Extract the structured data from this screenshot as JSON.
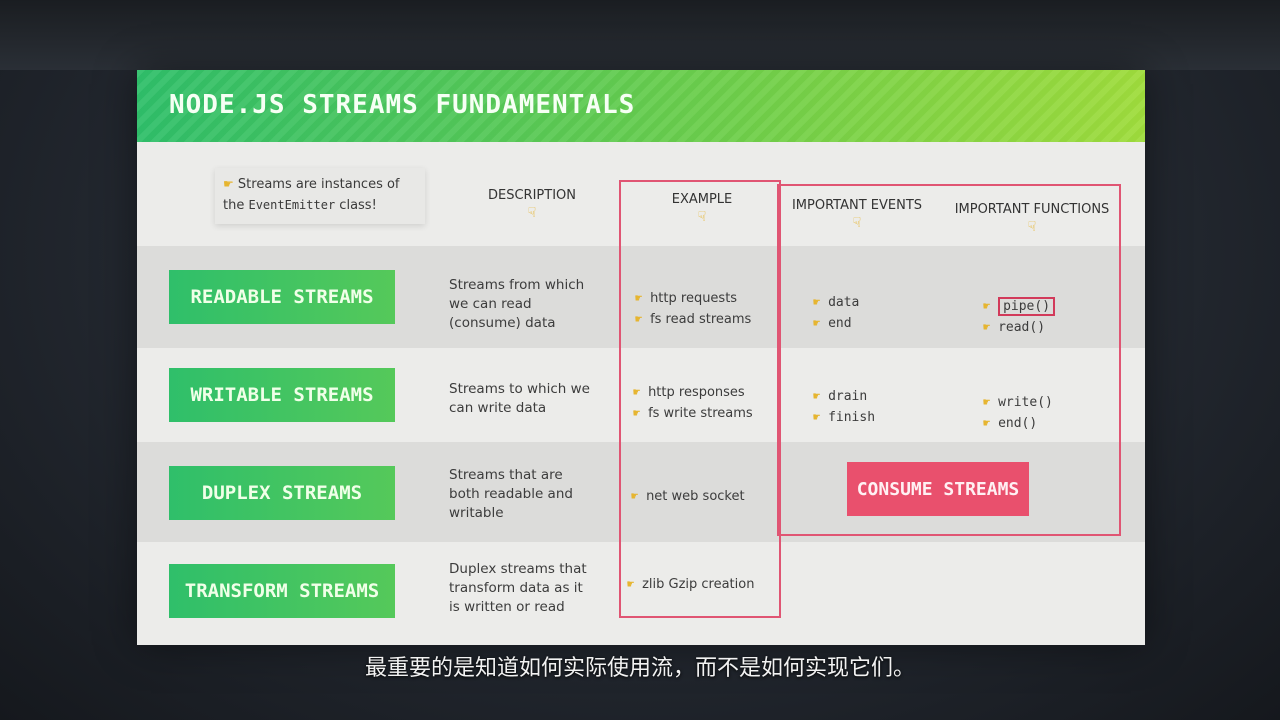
{
  "slide": {
    "title": "NODE.JS STREAMS FUNDAMENTALS",
    "note": {
      "line1": "Streams are instances of",
      "line2_prefix": "the ",
      "line2_code": "EventEmitter",
      "line2_suffix": " class!"
    },
    "headers": {
      "description": "DESCRIPTION",
      "example": "EXAMPLE",
      "events": "IMPORTANT EVENTS",
      "functions": "IMPORTANT FUNCTIONS"
    },
    "rows": [
      {
        "label": "READABLE STREAMS",
        "desc": [
          "Streams from which",
          "we can read",
          "(consume) data"
        ],
        "examples": [
          "http requests",
          "fs read streams"
        ],
        "events": [
          "data",
          "end"
        ],
        "functions": [
          "pipe()",
          "read()"
        ]
      },
      {
        "label": "WRITABLE  STREAMS",
        "desc": [
          "Streams to which we",
          "can write data"
        ],
        "examples": [
          "http responses",
          "fs write streams"
        ],
        "events": [
          "drain",
          "finish"
        ],
        "functions": [
          "write()",
          "end()"
        ]
      },
      {
        "label": "DUPLEX  STREAMS",
        "desc": [
          "Streams that are",
          "both readable and",
          "writable"
        ],
        "examples": [
          "net web socket"
        ]
      },
      {
        "label": "TRANSFORM  STREAMS",
        "desc": [
          "Duplex streams that",
          "transform data as it",
          "is written or read"
        ],
        "examples": [
          "zlib Gzip creation"
        ]
      }
    ],
    "consume_label": "CONSUME STREAMS"
  },
  "caption": "最重要的是知道如何实际使用流，而不是如何实现它们。",
  "colors": {
    "green": "#2fbf6a",
    "pink": "#e9506d",
    "red_outline": "#e05573",
    "bullet": "#e6b530"
  }
}
